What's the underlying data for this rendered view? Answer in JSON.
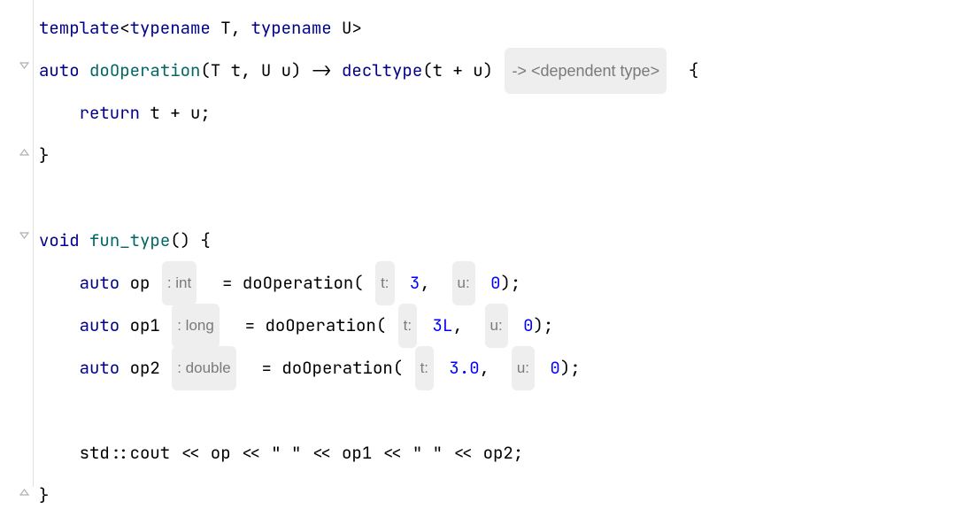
{
  "code": {
    "l1": {
      "kw1": "template",
      "lt": "<",
      "kw2": "typename",
      "t1": " T",
      "comma": ", ",
      "kw3": "typename",
      "t2": " U",
      "gt": ">"
    },
    "l2": {
      "kw": "auto",
      "fn": "doOperation",
      "sig": "(T t, U u) -> ",
      "decl": "decltype",
      "args": "(t + u) ",
      "hint": "-> <dependent type>",
      "brace": "  {"
    },
    "l3": {
      "indent": "    ",
      "kw": "return",
      "expr": " t + u;"
    },
    "l4": {
      "brace": "}"
    },
    "l5": {
      "blank": ""
    },
    "l6": {
      "kw": "void",
      "sp": " ",
      "fn": "fun_type",
      "rest": "() {"
    },
    "l7": {
      "indent": "    ",
      "kw": "auto",
      "var": " op ",
      "hint": ": int",
      "eq": "  = ",
      "call": "doOperation",
      "open": "( ",
      "h1": "t:",
      "v1": " 3",
      "c": ",  ",
      "h2": "u:",
      "v2": " 0",
      "close": ");"
    },
    "l8": {
      "indent": "    ",
      "kw": "auto",
      "var": " op1 ",
      "hint": ": long",
      "eq": "  = ",
      "call": "doOperation",
      "open": "( ",
      "h1": "t:",
      "v1": " 3L",
      "c": ",  ",
      "h2": "u:",
      "v2": " 0",
      "close": ");"
    },
    "l9": {
      "indent": "    ",
      "kw": "auto",
      "var": " op2 ",
      "hint": ": double",
      "eq": "  = ",
      "call": "doOperation",
      "open": "( ",
      "h1": "t:",
      "v1": " 3.0",
      "c": ",  ",
      "h2": "u:",
      "v2": " 0",
      "close": ");"
    },
    "l10": {
      "blank": ""
    },
    "l11": {
      "indent": "    ",
      "stdcout": "std::cout << op << ",
      "q1": "\" \"",
      "mid": " << op1 << ",
      "q2": "\" \"",
      "end": " << op2;"
    },
    "l12": {
      "brace": "}"
    }
  }
}
